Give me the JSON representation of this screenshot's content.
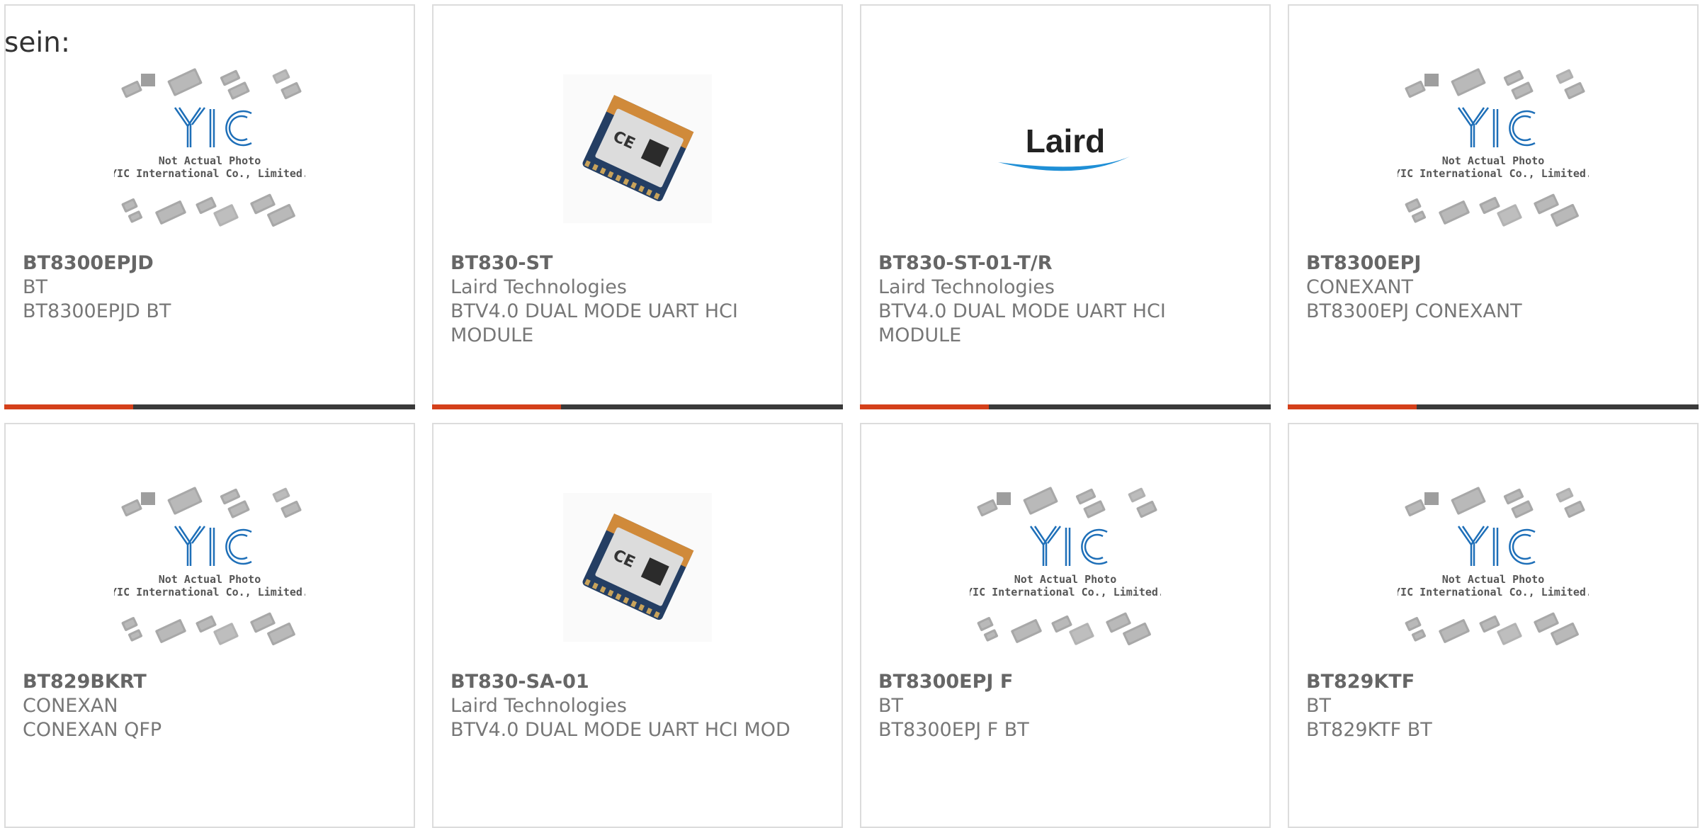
{
  "prefix_text": "sein:",
  "placeholder": {
    "line1": "Not Actual Photo",
    "line2": "YIC International Co., Limited."
  },
  "laird_logo_text": "Laird",
  "colors": {
    "accent": "#d4401a",
    "bar": "#3a3a3a",
    "border": "#dcdcdc",
    "yic_blue": "#1e6fb8"
  },
  "products": [
    {
      "part": "BT8300EPJD",
      "manufacturer": "BT",
      "description": "BT8300EPJD BT",
      "image": "yic-placeholder"
    },
    {
      "part": "BT830-ST",
      "manufacturer": "Laird Technologies",
      "description": "BTV4.0 DUAL MODE UART HCI MODULE",
      "image": "module-photo"
    },
    {
      "part": "BT830-ST-01-T/R",
      "manufacturer": "Laird Technologies",
      "description": "BTV4.0 DUAL MODE UART HCI MODULE",
      "image": "laird-logo"
    },
    {
      "part": "BT8300EPJ",
      "manufacturer": "CONEXANT",
      "description": "BT8300EPJ CONEXANT",
      "image": "yic-placeholder"
    },
    {
      "part": "BT829BKRT",
      "manufacturer": "CONEXAN",
      "description": "CONEXAN QFP",
      "image": "yic-placeholder"
    },
    {
      "part": "BT830-SA-01",
      "manufacturer": "Laird Technologies",
      "description": "BTV4.0 DUAL MODE UART HCI MOD",
      "image": "module-photo"
    },
    {
      "part": "BT8300EPJ F",
      "manufacturer": "BT",
      "description": "BT8300EPJ F BT",
      "image": "yic-placeholder"
    },
    {
      "part": "BT829KTF",
      "manufacturer": "BT",
      "description": "BT829KTF BT",
      "image": "yic-placeholder"
    }
  ]
}
